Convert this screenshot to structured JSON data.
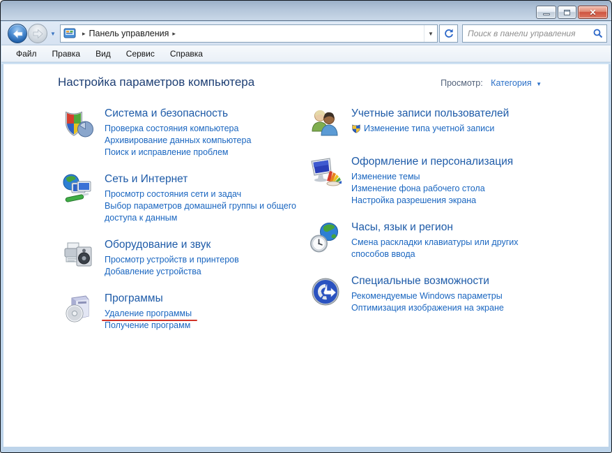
{
  "window": {
    "controls": [
      {
        "name": "minimize-button",
        "icon": "minimize-icon"
      },
      {
        "name": "maximize-button",
        "icon": "maximize-icon"
      },
      {
        "name": "close-button",
        "icon": "close-icon",
        "glyph": "✕"
      }
    ],
    "frame_color": "#bdd4ea",
    "titlebar_gradient": [
      "#9bb0c8",
      "#c9d8e8"
    ]
  },
  "nav": {
    "back_icon": "back-arrow-icon",
    "forward_icon": "forward-arrow-icon",
    "breadcrumb": {
      "icon": "control-panel-icon",
      "items": [
        "Панель управления"
      ]
    },
    "refresh_icon": "refresh-icon",
    "search": {
      "placeholder": "Поиск в панели управления",
      "icon": "search-icon"
    }
  },
  "menubar": {
    "items": [
      "Файл",
      "Правка",
      "Вид",
      "Сервис",
      "Справка"
    ]
  },
  "header": {
    "title": "Настройка параметров компьютера",
    "view_label": "Просмотр:",
    "view_value": "Категория",
    "view_arrow": "▼"
  },
  "colors": {
    "heading": "#1e3f74",
    "category_title": "#1e5ba8",
    "link": "#1a66c0",
    "annotation_red": "#d13328"
  },
  "categories": {
    "left": [
      {
        "icon": "security-shield-icon",
        "title": "Система и безопасность",
        "links": [
          {
            "text": "Проверка состояния компьютера"
          },
          {
            "text": "Архивирование данных компьютера"
          },
          {
            "text": "Поиск и исправление проблем"
          }
        ]
      },
      {
        "icon": "network-internet-icon",
        "title": "Сеть и Интернет",
        "links": [
          {
            "text": "Просмотр состояния сети и задач"
          },
          {
            "text": "Выбор параметров домашней группы и общего доступа к данным"
          }
        ]
      },
      {
        "icon": "hardware-sound-icon",
        "title": "Оборудование и звук",
        "links": [
          {
            "text": "Просмотр устройств и принтеров"
          },
          {
            "text": "Добавление устройства"
          }
        ]
      },
      {
        "icon": "programs-icon",
        "title": "Программы",
        "links": [
          {
            "text": "Удаление программы",
            "annotation": "red-underline"
          },
          {
            "text": "Получение программ"
          }
        ]
      }
    ],
    "right": [
      {
        "icon": "user-accounts-icon",
        "title": "Учетные записи пользователей",
        "links": [
          {
            "text": "Изменение типа учетной записи",
            "uac_shield": true
          }
        ]
      },
      {
        "icon": "personalization-icon",
        "title": "Оформление и персонализация",
        "links": [
          {
            "text": "Изменение темы"
          },
          {
            "text": "Изменение фона рабочего стола"
          },
          {
            "text": "Настройка разрешения экрана"
          }
        ]
      },
      {
        "icon": "clock-language-region-icon",
        "title": "Часы, язык и регион",
        "links": [
          {
            "text": "Смена раскладки клавиатуры или других способов ввода"
          }
        ]
      },
      {
        "icon": "ease-of-access-icon",
        "title": "Специальные возможности",
        "links": [
          {
            "text": "Рекомендуемые Windows параметры"
          },
          {
            "text": "Оптимизация изображения на экране"
          }
        ]
      }
    ]
  }
}
